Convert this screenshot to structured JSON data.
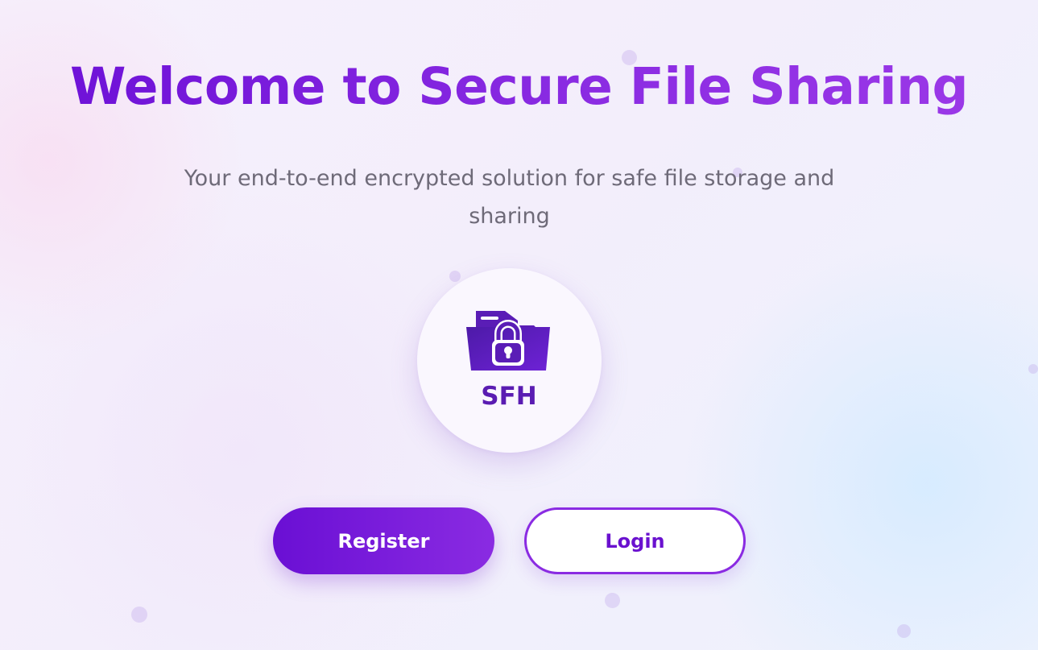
{
  "hero": {
    "title": "Welcome to Secure File Sharing",
    "subtitle": "Your end-to-end encrypted solution for safe file storage and sharing"
  },
  "logo": {
    "icon": "locked-folder-icon",
    "text": "SFH"
  },
  "actions": {
    "register_label": "Register",
    "login_label": "Login"
  },
  "colors": {
    "accent": "#8a2be2",
    "accent_dark": "#6a0fd4",
    "subtitle": "#6e6a78",
    "logo_text": "#5a1cb2"
  }
}
